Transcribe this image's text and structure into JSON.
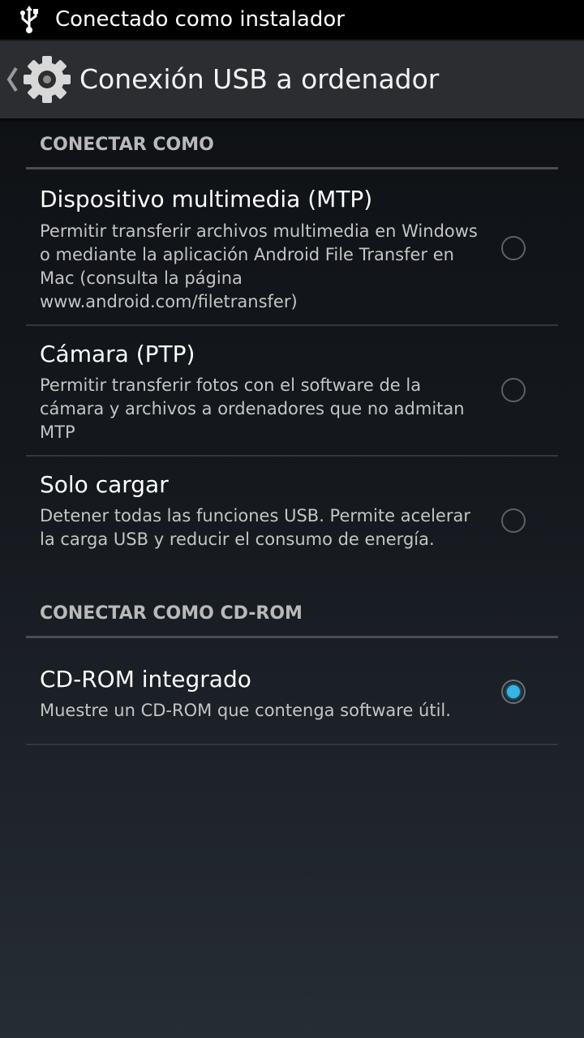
{
  "status_bar": {
    "icon": "usb-icon",
    "text": "Conectado como instalador"
  },
  "action_bar": {
    "back_icon": "chevron-left-icon",
    "app_icon": "gear-icon",
    "title": "Conexión USB a ordenador"
  },
  "sections": [
    {
      "header": "CONECTAR COMO",
      "options": [
        {
          "title": "Dispositivo multimedia (MTP)",
          "description": "Permitir transferir archivos multimedia en Windows o mediante la aplicación Android File Transfer en Mac (consulta la página www.android.com/filetransfer)",
          "selected": false
        },
        {
          "title": "Cámara (PTP)",
          "description": "Permitir transferir fotos con el software de la cámara y archivos a ordenadores que no admitan MTP",
          "selected": false
        },
        {
          "title": "Solo cargar",
          "description": "Detener todas las funciones USB. Permite acelerar la carga USB y reducir el consumo de energía.",
          "selected": false
        }
      ]
    },
    {
      "header": "CONECTAR COMO CD-ROM",
      "options": [
        {
          "title": "CD-ROM integrado",
          "description": "Muestre un CD-ROM que contenga software útil.",
          "selected": true
        }
      ]
    }
  ],
  "colors": {
    "accent": "#35b5e5",
    "section_header": "#b9b9b9",
    "action_bar": "#2b2d30"
  }
}
